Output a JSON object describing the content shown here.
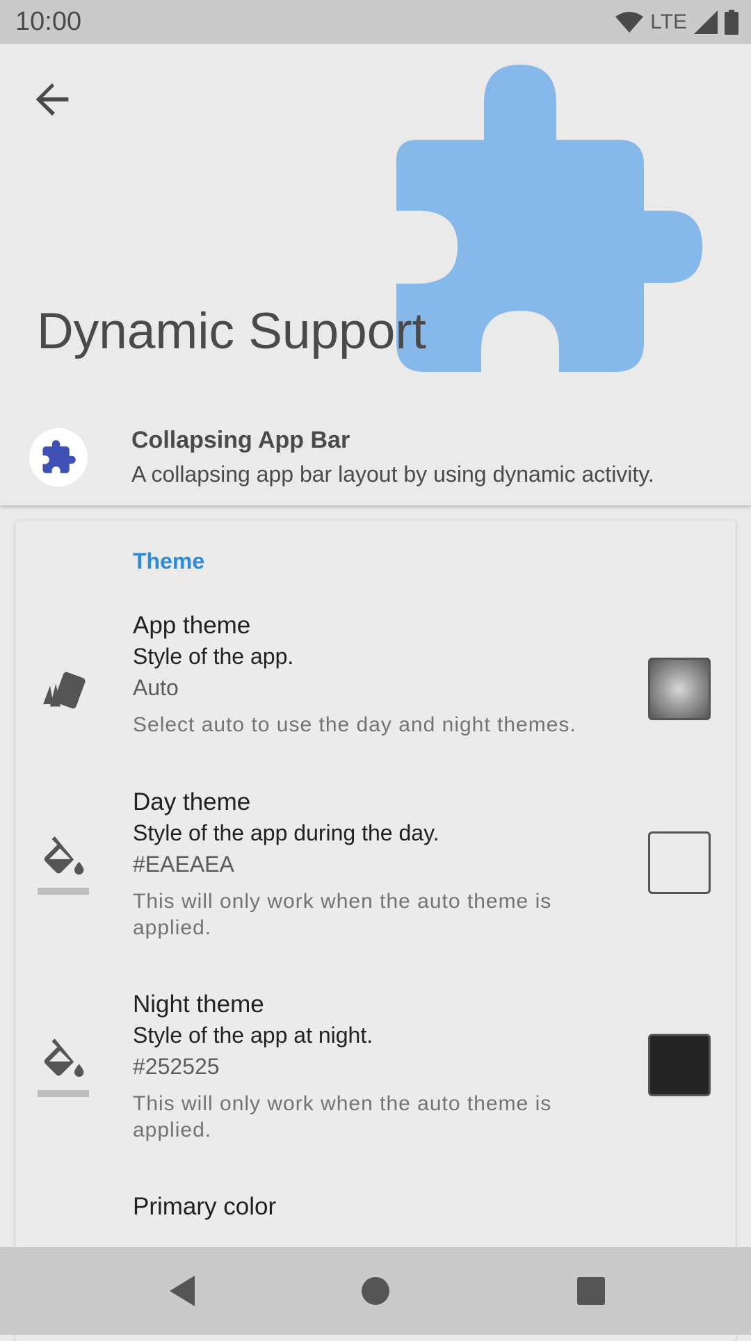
{
  "status_bar": {
    "time": "10:00",
    "network_label": "LTE",
    "icons": [
      "wifi-icon",
      "signal-icon",
      "battery-icon"
    ]
  },
  "header": {
    "title": "Dynamic Support",
    "back_icon": "arrow-back-icon",
    "hero_icon": "puzzle-icon",
    "app_name": "Collapsing App Bar",
    "app_description": "A collapsing app bar layout by using dynamic activity."
  },
  "card": {
    "section_header": "Theme",
    "preferences": [
      {
        "icon": "palette-swatch-icon",
        "title": "App theme",
        "summary": "Style of the app.",
        "value": "Auto",
        "description": "Select auto to use the day and night themes.",
        "swatch": "auto-gradient"
      },
      {
        "icon": "paint-bucket-icon",
        "title": "Day theme",
        "summary": "Style of the app during the day.",
        "value": "#EAEAEA",
        "description": "This will only work when the auto theme is applied.",
        "swatch": "#EAEAEA"
      },
      {
        "icon": "paint-bucket-icon",
        "title": "Night theme",
        "summary": "Style of the app at night.",
        "value": "#252525",
        "description": "This will only work when the auto theme is applied.",
        "swatch": "#252525"
      },
      {
        "title": "Primary color"
      }
    ]
  },
  "nav_bar": {
    "icons": [
      "back-triangle-icon",
      "home-circle-icon",
      "recents-square-icon"
    ]
  },
  "colors": {
    "accent": "#2E8BDA",
    "hero_puzzle": "#86B8E9",
    "app_icon_puzzle": "#3F51B5",
    "background": "#EAEAEA"
  }
}
